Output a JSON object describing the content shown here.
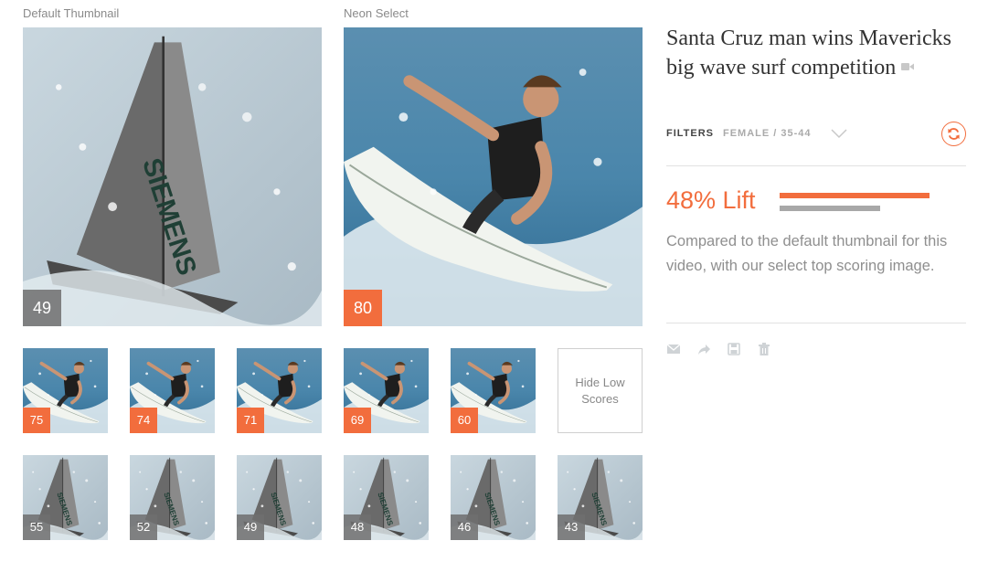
{
  "columns": {
    "default_label": "Default Thumbnail",
    "neon_label": "Neon Select"
  },
  "default_thumb": {
    "score": "49",
    "subject": "sailboat"
  },
  "neon_thumb": {
    "score": "80",
    "subject": "surfer"
  },
  "surfer_thumbs": [
    {
      "score": "75"
    },
    {
      "score": "74"
    },
    {
      "score": "71"
    },
    {
      "score": "69"
    },
    {
      "score": "60"
    }
  ],
  "hide_low_label": "Hide Low Scores",
  "sailboat_thumbs": [
    {
      "score": "55"
    },
    {
      "score": "52"
    },
    {
      "score": "49"
    },
    {
      "score": "48"
    },
    {
      "score": "46"
    },
    {
      "score": "43"
    }
  ],
  "video": {
    "title": "Santa Cruz man wins Mavericks big wave surf competition",
    "icon": "video-camera-icon"
  },
  "filters": {
    "label": "FILTERS",
    "value": "FEMALE / 35-44",
    "dropdown_icon": "chevron-down-icon",
    "refresh_icon": "refresh-icon"
  },
  "lift": {
    "text": "48% Lift",
    "neon_bar_fraction": 1.0,
    "default_bar_fraction": 0.67
  },
  "compare_text": "Compared to the default thumbnail for this video, with our select top scoring image.",
  "actions": [
    {
      "name": "email-icon"
    },
    {
      "name": "share-icon"
    },
    {
      "name": "save-icon"
    },
    {
      "name": "trash-icon"
    }
  ],
  "colors": {
    "accent": "#f26d3d",
    "gray_badge": "#6e6e6e",
    "text_muted": "#8f8f8f"
  }
}
